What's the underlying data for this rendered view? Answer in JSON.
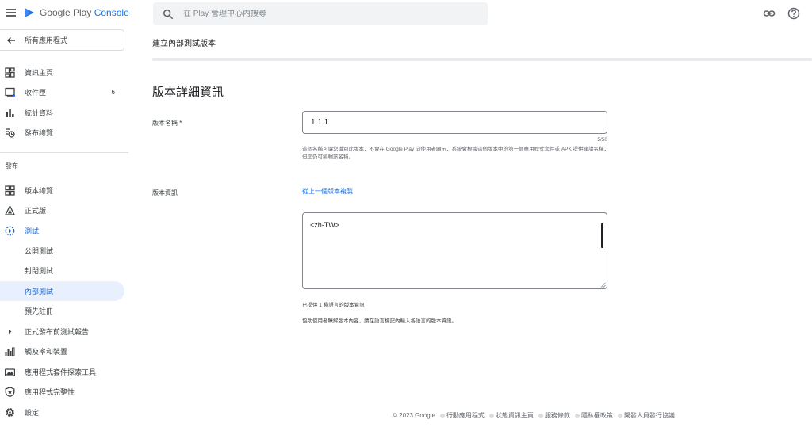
{
  "header": {
    "brand_prefix": "Google Play",
    "brand_accent": "Console",
    "search_placeholder": "在 Play 管理中心內搜尋",
    "icons": [
      "menu-icon",
      "play-console-logo-icon",
      "search-icon",
      "link-icon",
      "help-icon"
    ]
  },
  "sidebar": {
    "back_label": "所有應用程式",
    "items_top": [
      {
        "label": "資訊主頁",
        "icon": "dashboard-icon"
      },
      {
        "label": "收件匣",
        "icon": "inbox-icon",
        "count": "6"
      },
      {
        "label": "統計資料",
        "icon": "bar-chart-icon"
      },
      {
        "label": "發布總覽",
        "icon": "publishing-overview-icon"
      }
    ],
    "section_release": "發布",
    "items_release": [
      {
        "label": "版本總覽",
        "icon": "releases-overview-icon"
      },
      {
        "label": "正式版",
        "icon": "production-icon"
      },
      {
        "label": "測試",
        "icon": "testing-icon"
      },
      {
        "label": "公開測試"
      },
      {
        "label": "封閉測試"
      },
      {
        "label": "內部測試"
      },
      {
        "label": "預先註冊"
      },
      {
        "label": "正式發布前測試報告",
        "icon": "expand-arrow-icon"
      },
      {
        "label": "觸及率和裝置",
        "icon": "reach-devices-icon"
      },
      {
        "label": "應用程式套件探索工具",
        "icon": "bundle-explorer-icon"
      },
      {
        "label": "應用程式完整性",
        "icon": "app-integrity-icon"
      },
      {
        "label": "設定",
        "icon": "settings-icon"
      }
    ]
  },
  "main": {
    "page_title": "建立內部測試版本",
    "section_title": "版本詳細資訊",
    "release_name": {
      "label": "版本名稱 *",
      "value": "1.1.1",
      "counter": "5/50",
      "helper": "這個名稱可讓您識別此版本，不會在 Google Play 向使用者顯示，系統會根據這個版本中的第一個應用程式套件或 APK 提供建議名稱，但您仍可編輯該名稱。"
    },
    "release_notes": {
      "label": "版本資訊",
      "copy_link": "從上一個版本複製",
      "value": "<zh-TW>",
      "languages_note": "已提供 1 種語言的版本資訊",
      "help": "協助使用者瞭解版本內容，請在語言標記內輸入各語言的版本資訊。"
    }
  },
  "footer": {
    "copyright": "© 2023 Google",
    "links": [
      "行動應用程式",
      "狀態資訊主頁",
      "服務條款",
      "隱私權政策",
      "開發人員發行協議"
    ]
  },
  "colors": {
    "accent": "#1a73e8",
    "active_bg": "#e8f0fe",
    "active_text": "#1967d2"
  }
}
